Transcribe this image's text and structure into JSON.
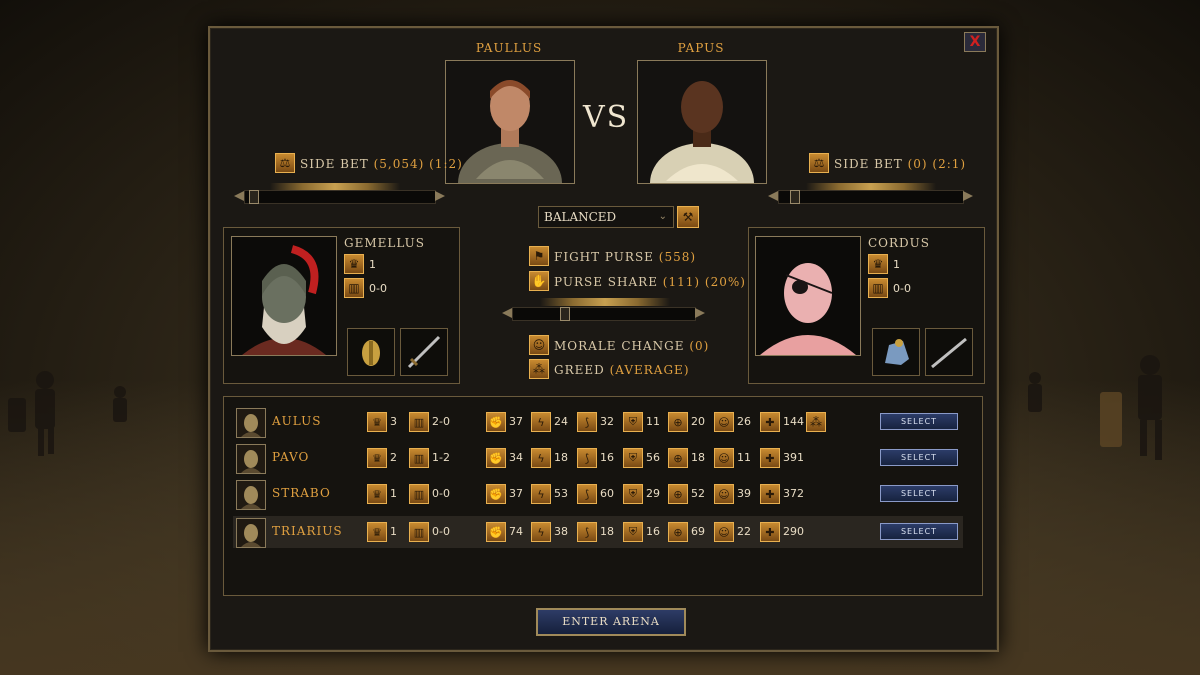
{
  "colors": {
    "accent": "#e0a040",
    "text": "#d8c8a8",
    "panel": "#1b1814",
    "button_blue": "#22305a"
  },
  "close": {
    "label": "X"
  },
  "top": {
    "left_name": "PAULLUS",
    "right_name": "PAPUS",
    "vs": "VS"
  },
  "side_bet_left": {
    "label": "SIDE BET",
    "amount": "(5,054)",
    "odds": "(1:2)",
    "slider_level": 0.02
  },
  "side_bet_right": {
    "label": "SIDE BET",
    "amount": "(0)",
    "odds": "(2:1)",
    "slider_level": 0.06
  },
  "stance": {
    "selected": "BALANCED"
  },
  "fight": {
    "purse_label": "FIGHT PURSE",
    "purse_value": "(558)",
    "share_label": "PURSE SHARE",
    "share_value": "(111)",
    "share_pct": "(20%)",
    "share_slider_level": 0.27,
    "morale_label": "MORALE CHANGE",
    "morale_value": "(0)",
    "greed_label": "GREED",
    "greed_value": "(AVERAGE)"
  },
  "left_fighter": {
    "name": "GEMELLUS",
    "wins": "1",
    "record": "0-0",
    "equip": [
      "helmet-icon",
      "sword-icon"
    ]
  },
  "right_fighter": {
    "name": "CORDUS",
    "wins": "1",
    "record": "0-0",
    "equip": [
      "armor-icon",
      "sword-icon"
    ]
  },
  "roster": [
    {
      "name": "AULUS",
      "wins": "3",
      "record": "2-0",
      "str": "37",
      "agi": "24",
      "spd": "32",
      "con": "11",
      "acc": "20",
      "mor": "26",
      "hp": "144",
      "select": "SELECT",
      "extra_icon": true
    },
    {
      "name": "PAVO",
      "wins": "2",
      "record": "1-2",
      "str": "34",
      "agi": "18",
      "spd": "16",
      "con": "56",
      "acc": "18",
      "mor": "11",
      "hp": "391",
      "select": "SELECT"
    },
    {
      "name": "STRABO",
      "wins": "1",
      "record": "0-0",
      "str": "37",
      "agi": "53",
      "spd": "60",
      "con": "29",
      "acc": "52",
      "mor": "39",
      "hp": "372",
      "select": "SELECT"
    },
    {
      "name": "TRIARIUS",
      "wins": "1",
      "record": "0-0",
      "str": "74",
      "agi": "38",
      "spd": "18",
      "con": "16",
      "acc": "69",
      "mor": "22",
      "hp": "290",
      "select": "SELECT",
      "highlighted": true
    }
  ],
  "enter_button": "ENTER ARENA"
}
